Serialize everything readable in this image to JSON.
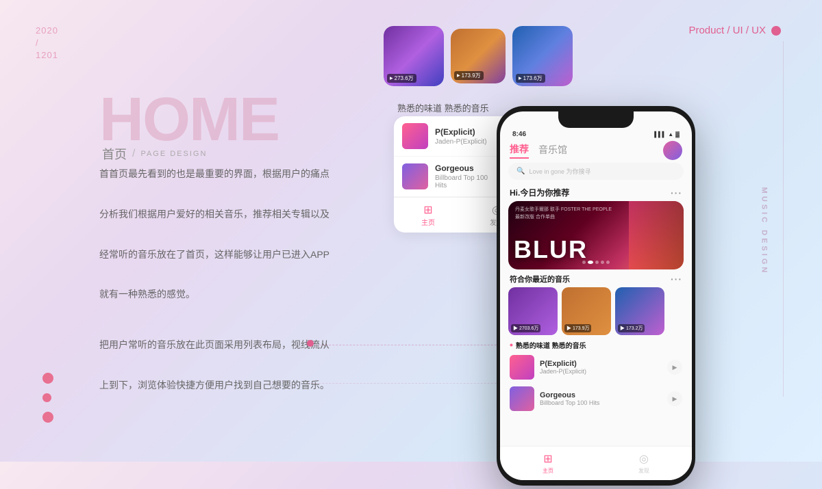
{
  "date": {
    "year": "2020",
    "slash": "/",
    "num": "1201"
  },
  "product_label": "Product / UI / UX",
  "music_design": "MUSIC DESIGN",
  "home": {
    "big": "HOME",
    "cn": "首页",
    "slash": "/",
    "page_design": "PAGE DESIGN"
  },
  "desc1": "首首页最先看到的也是最重要的界面，根据用户的痛点\n\n分析我们根据用户爱好的相关音乐，推荐相关专辑以及\n\n经常听的音乐放在了首页，这样能够让用户已进入APP\n\n就有一种熟悉的感觉。",
  "desc2": "把用户常听的音乐放在此页面采用列表布局，视线流从\n\n上到下，浏览体验快捷方便用户找到自己想要的音乐。",
  "section_label": "熟悉的味道 熟悉的音乐",
  "top_albums": [
    {
      "id": 1,
      "badge": "273.6万",
      "class": "album-1"
    },
    {
      "id": 2,
      "badge": "173.9万",
      "class": "album-2"
    },
    {
      "id": 3,
      "badge": "173.6万",
      "class": "album-3"
    }
  ],
  "list_items": [
    {
      "title": "P(Explicit)",
      "sub": "Jaden-P(Explicit)",
      "class": "lt1"
    },
    {
      "title": "Gorgeous",
      "sub": "Billboard Top 100 Hits",
      "class": "lt2"
    }
  ],
  "nav": {
    "home": "主页",
    "discover": "发现"
  },
  "phone": {
    "time": "8:46",
    "tabs": [
      "推荐",
      "音乐馆"
    ],
    "search_placeholder": "Love in gone 为你搜寻",
    "hi_text": "Hi.今日为你推荐",
    "blur_top": "丹麦女歌手爾那  联手 FOSTER THE PEOPLE\n最新改版 合作单曲",
    "blur_text": "BLUR",
    "section2": "符合你最近的音乐",
    "section3_label": "熟悉的味道 熟悉的音乐",
    "albums_small": [
      {
        "badge": "2703.6万",
        "class": "sa1"
      },
      {
        "badge": "173.9万",
        "class": "sa2"
      },
      {
        "badge": "173.2万",
        "class": "sa3"
      }
    ],
    "list_items": [
      {
        "title": "P(Explicit)",
        "sub": "Jaden-P(Explicit)",
        "class": "plt1"
      },
      {
        "title": "Gorgeous",
        "sub": "Billboard Top 100 Hits",
        "class": "plt2"
      }
    ],
    "nav_items": [
      {
        "label": "主页",
        "active": true
      },
      {
        "label": "发现",
        "active": false
      }
    ]
  }
}
